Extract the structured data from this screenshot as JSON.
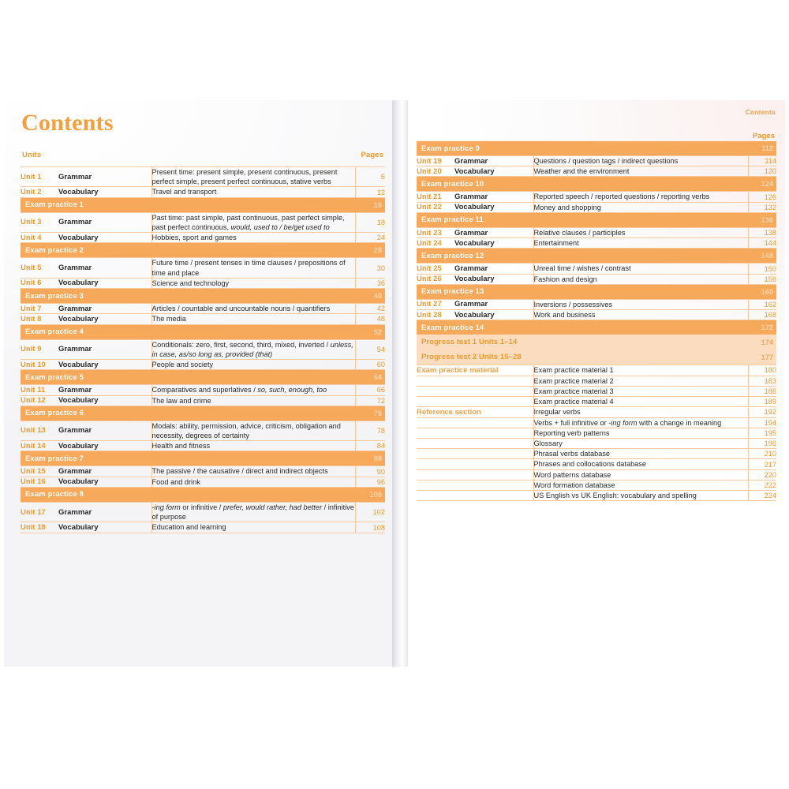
{
  "document": {
    "title": "Contents",
    "running_head": "Contents",
    "accent_color": "#EE9B2D",
    "bar_color": "#F6A95B",
    "soft_bar_color": "#FBDCBE",
    "rule_color": "#F6C9A0"
  },
  "left_page": {
    "headers": {
      "units": "Units",
      "pages": "Pages"
    },
    "rows": [
      {
        "type": "unit",
        "unit": "Unit 1",
        "kind": "Grammar",
        "desc": "Present time: present simple, present continuous, present perfect simple, present perfect continuous, stative verbs",
        "page": "6"
      },
      {
        "type": "unit",
        "unit": "Unit 2",
        "kind": "Vocabulary",
        "desc": "Travel and transport",
        "page": "12"
      },
      {
        "type": "bar",
        "label": "Exam practice 1",
        "page": "16"
      },
      {
        "type": "unit",
        "unit": "Unit 3",
        "kind": "Grammar",
        "desc": "Past time: past simple, past continuous, past perfect simple, past perfect continuous, would, used to / be/get used to",
        "page": "18"
      },
      {
        "type": "unit",
        "unit": "Unit 4",
        "kind": "Vocabulary",
        "desc": "Hobbies, sport and games",
        "page": "24"
      },
      {
        "type": "bar",
        "label": "Exam practice 2",
        "page": "28"
      },
      {
        "type": "unit",
        "unit": "Unit 5",
        "kind": "Grammar",
        "desc": "Future time / present tenses in time clauses / prepositions of time and place",
        "page": "30"
      },
      {
        "type": "unit",
        "unit": "Unit 6",
        "kind": "Vocabulary",
        "desc": "Science and technology",
        "page": "36"
      },
      {
        "type": "bar",
        "label": "Exam practice 3",
        "page": "40"
      },
      {
        "type": "unit",
        "unit": "Unit 7",
        "kind": "Grammar",
        "desc": "Articles / countable and uncountable nouns / quantifiers",
        "page": "42"
      },
      {
        "type": "unit",
        "unit": "Unit 8",
        "kind": "Vocabulary",
        "desc": "The media",
        "page": "48"
      },
      {
        "type": "bar",
        "label": "Exam practice 4",
        "page": "52"
      },
      {
        "type": "unit",
        "unit": "Unit 9",
        "kind": "Grammar",
        "desc": "Conditionals: zero, first, second, third, mixed, inverted / unless, in case, as/so long as, provided (that)",
        "page": "54"
      },
      {
        "type": "unit",
        "unit": "Unit 10",
        "kind": "Vocabulary",
        "desc": "People and society",
        "page": "60"
      },
      {
        "type": "bar",
        "label": "Exam practice 5",
        "page": "64"
      },
      {
        "type": "unit",
        "unit": "Unit 11",
        "kind": "Grammar",
        "desc": "Comparatives and superlatives / so, such, enough, too",
        "page": "66"
      },
      {
        "type": "unit",
        "unit": "Unit 12",
        "kind": "Vocabulary",
        "desc": "The law and crime",
        "page": "72"
      },
      {
        "type": "bar",
        "label": "Exam practice 6",
        "page": "76"
      },
      {
        "type": "unit",
        "unit": "Unit 13",
        "kind": "Grammar",
        "desc": "Modals: ability, permission, advice, criticism, obligation and necessity, degrees of certainty",
        "page": "78"
      },
      {
        "type": "unit",
        "unit": "Unit 14",
        "kind": "Vocabulary",
        "desc": "Health and fitness",
        "page": "84"
      },
      {
        "type": "bar",
        "label": "Exam practice 7",
        "page": "88"
      },
      {
        "type": "unit",
        "unit": "Unit 15",
        "kind": "Grammar",
        "desc": "The passive / the causative / direct and indirect objects",
        "page": "90"
      },
      {
        "type": "unit",
        "unit": "Unit 16",
        "kind": "Vocabulary",
        "desc": "Food and drink",
        "page": "96"
      },
      {
        "type": "bar",
        "label": "Exam practice 8",
        "page": "100"
      },
      {
        "type": "unit",
        "unit": "Unit 17",
        "kind": "Grammar",
        "desc": "-ing form or infinitive / prefer, would rather, had better / infinitive of purpose",
        "page": "102"
      },
      {
        "type": "unit",
        "unit": "Unit 18",
        "kind": "Vocabulary",
        "desc": "Education and learning",
        "page": "108"
      }
    ]
  },
  "right_page": {
    "headers": {
      "pages": "Pages"
    },
    "rows": [
      {
        "type": "bar",
        "label": "Exam practice 9",
        "page": "112"
      },
      {
        "type": "unit",
        "unit": "Unit 19",
        "kind": "Grammar",
        "desc": "Questions / question tags / indirect questions",
        "page": "114"
      },
      {
        "type": "unit",
        "unit": "Unit 20",
        "kind": "Vocabulary",
        "desc": "Weather and the environment",
        "page": "120"
      },
      {
        "type": "bar",
        "label": "Exam practice 10",
        "page": "124"
      },
      {
        "type": "unit",
        "unit": "Unit 21",
        "kind": "Grammar",
        "desc": "Reported speech / reported questions / reporting verbs",
        "page": "126"
      },
      {
        "type": "unit",
        "unit": "Unit 22",
        "kind": "Vocabulary",
        "desc": "Money and shopping",
        "page": "132"
      },
      {
        "type": "bar",
        "label": "Exam practice 11",
        "page": "136"
      },
      {
        "type": "unit",
        "unit": "Unit 23",
        "kind": "Grammar",
        "desc": "Relative clauses / participles",
        "page": "138"
      },
      {
        "type": "unit",
        "unit": "Unit 24",
        "kind": "Vocabulary",
        "desc": "Entertainment",
        "page": "144"
      },
      {
        "type": "bar",
        "label": "Exam practice 12",
        "page": "148"
      },
      {
        "type": "unit",
        "unit": "Unit 25",
        "kind": "Grammar",
        "desc": "Unreal time / wishes / contrast",
        "page": "150"
      },
      {
        "type": "unit",
        "unit": "Unit 26",
        "kind": "Vocabulary",
        "desc": "Fashion and design",
        "page": "156"
      },
      {
        "type": "bar",
        "label": "Exam practice 13",
        "page": "160"
      },
      {
        "type": "unit",
        "unit": "Unit 27",
        "kind": "Grammar",
        "desc": "Inversions / possessives",
        "page": "162"
      },
      {
        "type": "unit",
        "unit": "Unit 28",
        "kind": "Vocabulary",
        "desc": "Work and business",
        "page": "168"
      },
      {
        "type": "bar",
        "label": "Exam practice 14",
        "page": "172"
      },
      {
        "type": "softbar",
        "label": "Progress test 1    Units 1–14",
        "page": "174"
      },
      {
        "type": "softbar",
        "label": "Progress test 2    Units 15–28",
        "page": "177"
      },
      {
        "type": "sect",
        "section": "Exam practice material",
        "desc": "Exam practice material 1",
        "page": "180"
      },
      {
        "type": "sect",
        "section": "",
        "desc": "Exam practice material 2",
        "page": "183"
      },
      {
        "type": "sect",
        "section": "",
        "desc": "Exam practice material 3",
        "page": "186"
      },
      {
        "type": "sect",
        "section": "",
        "desc": "Exam practice material 4",
        "page": "189"
      },
      {
        "type": "sect",
        "section": "Reference section",
        "desc": "Irregular verbs",
        "page": "192"
      },
      {
        "type": "sect",
        "section": "",
        "desc": "Verbs + full infinitive or -ing form with a change in meaning",
        "page": "194"
      },
      {
        "type": "sect",
        "section": "",
        "desc": "Reporting verb patterns",
        "page": "195"
      },
      {
        "type": "sect",
        "section": "",
        "desc": "Glossary",
        "page": "196"
      },
      {
        "type": "sect",
        "section": "",
        "desc": "Phrasal verbs database",
        "page": "210"
      },
      {
        "type": "sect",
        "section": "",
        "desc": "Phrases and collocations database",
        "page": "217"
      },
      {
        "type": "sect",
        "section": "",
        "desc": "Word patterns database",
        "page": "220"
      },
      {
        "type": "sect",
        "section": "",
        "desc": "Word formation database",
        "page": "222"
      },
      {
        "type": "sect",
        "section": "",
        "desc": "US English vs UK English: vocabulary and spelling",
        "page": "224"
      }
    ]
  },
  "italic_fragments": [
    "would, used to / be/get used to",
    "unless, in case, as/so long as, provided (that)",
    "so, such, enough, too",
    "prefer, would rather, had better",
    "-ing",
    "-ing form"
  ]
}
